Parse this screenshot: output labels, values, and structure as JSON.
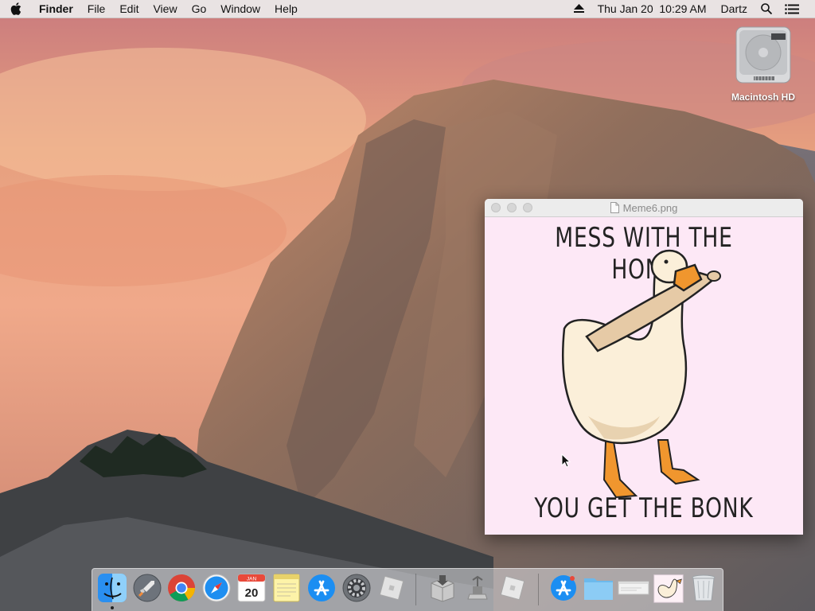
{
  "menubar": {
    "app_name": "Finder",
    "menus": [
      "File",
      "Edit",
      "View",
      "Go",
      "Window",
      "Help"
    ],
    "clock": "Thu Jan 20  10:29 AM",
    "user": "Dartz"
  },
  "desktop": {
    "icons": [
      {
        "label": "Macintosh HD",
        "icon": "hard-drive-icon"
      }
    ]
  },
  "preview_window": {
    "title": "Meme6.png",
    "meme_top_text": "MESS WITH THE HONK",
    "meme_bottom_text": "YOU GET THE BONK",
    "background_color": "#fde8f6"
  },
  "dock": {
    "calendar_month": "JAN",
    "calendar_day": "20",
    "apps": [
      "Finder",
      "Launchpad",
      "Chrome",
      "Safari",
      "Calendar",
      "Notes",
      "App Store",
      "System Preferences",
      "Roblox"
    ],
    "utilities": [
      "Installer",
      "Network Utility",
      "Roblox Studio"
    ],
    "stacks": [
      "App Store",
      "Folder",
      "Window",
      "Meme6.png",
      "Trash"
    ]
  }
}
